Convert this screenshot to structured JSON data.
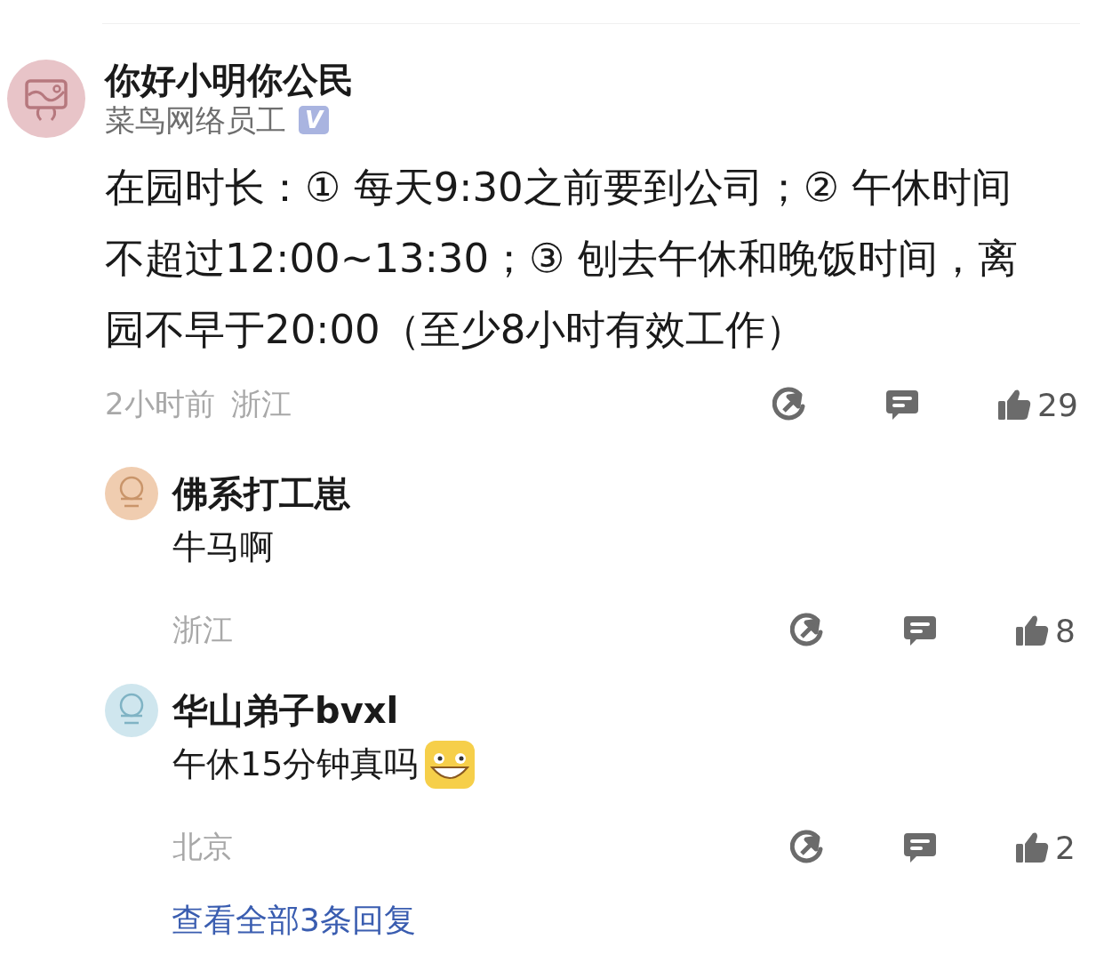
{
  "comment": {
    "author": "你好小明你公民",
    "color": "#e8c4c8",
    "subtitle": "菜鸟网络员工",
    "verified_badge": "V",
    "body": "在园时长：① 每天9:30之前要到公司；② 午休时间不超过12:00~13:30；③ 刨去午休和晚饭时间，离园不早于20:00（至少8小时有效工作）",
    "time": "2小时前",
    "location": "浙江",
    "likes": "29"
  },
  "replies": [
    {
      "author": "佛系打工崽",
      "color": "#f0cdb0",
      "text": "牛马啊",
      "sticker": false,
      "location": "浙江",
      "likes": "8"
    },
    {
      "author": "华山弟子bvxl",
      "color": "#cfe6ee",
      "text": "午休15分钟真吗",
      "sticker": true,
      "location": "北京",
      "likes": "2"
    }
  ],
  "view_all_link": "查看全部3条回复"
}
